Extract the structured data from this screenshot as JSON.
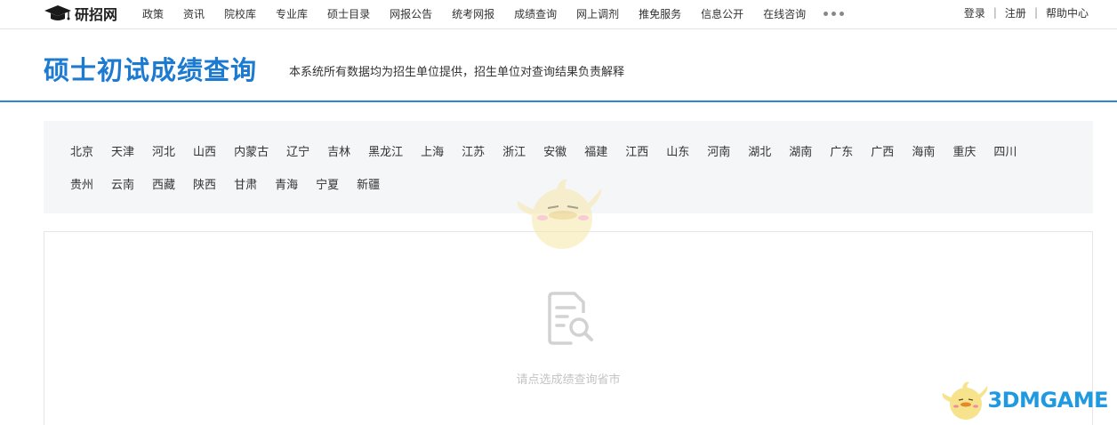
{
  "logo": {
    "text": "研招网"
  },
  "nav": {
    "items": [
      "政策",
      "资讯",
      "院校库",
      "专业库",
      "硕士目录",
      "网报公告",
      "统考网报",
      "成绩查询",
      "网上调剂",
      "推免服务",
      "信息公开",
      "在线咨询"
    ]
  },
  "user_links": {
    "login": "登录",
    "register": "注册",
    "help": "帮助中心",
    "separator": "|"
  },
  "header": {
    "title": "硕士初试成绩查询",
    "subtitle": "本系统所有数据均为招生单位提供，招生单位对查询结果负责解释"
  },
  "provinces": {
    "row1": [
      "北京",
      "天津",
      "河北",
      "山西",
      "内蒙古",
      "辽宁",
      "吉林",
      "黑龙江",
      "上海",
      "江苏",
      "浙江",
      "安徽",
      "福建",
      "江西",
      "山东",
      "河南",
      "湖北",
      "湖南",
      "广东",
      "广西",
      "海南",
      "重庆",
      "四川"
    ],
    "row2": [
      "贵州",
      "云南",
      "西藏",
      "陕西",
      "甘肃",
      "青海",
      "宁夏",
      "新疆"
    ]
  },
  "result": {
    "empty_text": "请点选成绩查询省市"
  },
  "watermark": {
    "text": "3DMGAME"
  },
  "colors": {
    "accent": "#1c7ad0",
    "header_border": "#2b86d4",
    "panel_bg": "#f5f6f8",
    "placeholder": "#c4c4c4",
    "watermark": "#1f9ae0"
  }
}
